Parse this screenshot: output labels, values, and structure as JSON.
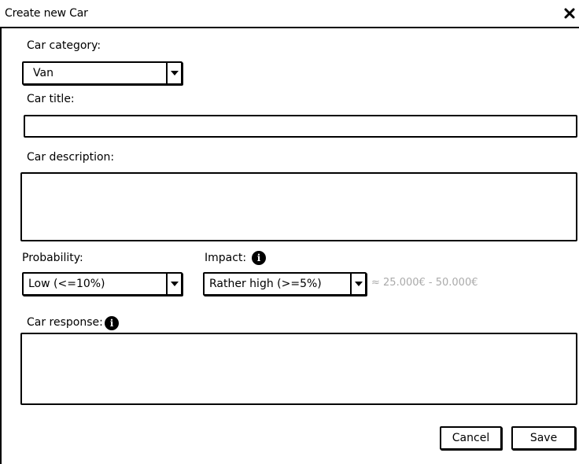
{
  "dialog": {
    "title": "Create new Car",
    "close_icon": "close-icon"
  },
  "form": {
    "category_label": "Car category:",
    "category_value": "Van",
    "title_label": "Car title:",
    "title_value": "",
    "description_label": "Car description:",
    "description_value": "",
    "probability_label": "Probability:",
    "probability_value": "Low (<=10%)",
    "impact_label": "Impact:",
    "impact_value": "Rather high (>=5%)",
    "impact_estimate": "≈ 25.000€ - 50.000€",
    "response_label": "Car response:",
    "response_value": "",
    "info_icon": "info-icon"
  },
  "buttons": {
    "cancel": "Cancel",
    "save": "Save"
  }
}
